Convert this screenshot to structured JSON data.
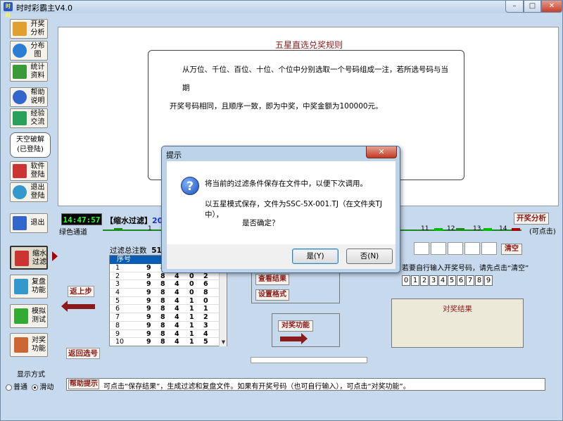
{
  "window": {
    "title": "时时彩霸主V4.0",
    "app_icon_text": "时时",
    "min": "–",
    "max": "□",
    "close": "✕"
  },
  "sidebar": {
    "items": [
      {
        "label": "开奖\n分析",
        "icon": "chart-icon",
        "color": "#e0a030"
      },
      {
        "label": "分布\n图",
        "icon": "globe-icon",
        "color": "#2a7fd4"
      },
      {
        "label": "统计\n资料",
        "icon": "stats-icon",
        "color": "#3a9a3a"
      },
      {
        "label": "帮助\n说明",
        "icon": "help-icon",
        "color": "#3366cc"
      },
      {
        "label": "经验\n交流",
        "icon": "users-icon",
        "color": "#2aa05a"
      }
    ],
    "account": {
      "title": "天空破解",
      "status": "(已登陆)"
    },
    "items2": [
      {
        "label": "软件\n登陆",
        "icon": "key-icon",
        "color": "#cc3333"
      },
      {
        "label": "退出\n登陆",
        "icon": "off-icon",
        "color": "#3399cc"
      },
      {
        "label": "退出",
        "icon": "exit-icon",
        "color": "#3366cc"
      }
    ],
    "modes": [
      {
        "label": "缩水\n过滤",
        "icon": "scissors-icon",
        "color": "#cc3333",
        "active": true
      },
      {
        "label": "复盘\n功能",
        "icon": "camera-icon",
        "color": "#3399cc",
        "active": false
      },
      {
        "label": "模拟\n测试",
        "icon": "refresh-icon",
        "color": "#33aa33",
        "active": false
      },
      {
        "label": "对奖\n功能",
        "icon": "puzzle-icon",
        "color": "#cc6633",
        "active": false
      }
    ],
    "display_label": "显示方式",
    "radio_normal": "普通",
    "radio_scroll": "滑动"
  },
  "rules": {
    "title": "五星直选兑奖规则",
    "line1": "从万位、千位、百位、十位、个位中分别选取一个号码组成一注，若所选号码与当期",
    "line2": "开奖号码相同，且顺序一致，即为中奖，中奖金额为100000元。"
  },
  "timebar": {
    "clock": "14:47:57",
    "filter_prefix": "【缩水过滤】",
    "year": "2016",
    "analyze_button": "开奖分析"
  },
  "green_channel": {
    "label": "绿色通道",
    "marks": [
      "1",
      "11",
      "12",
      "13",
      "14"
    ],
    "suffix": "(可点击)"
  },
  "left_panel": {
    "back_step": "返上步",
    "back_select": "返回选号",
    "total_label": "过滤总注数",
    "total_value": "51",
    "table_header": "序号",
    "rows": [
      {
        "n": "1",
        "d": [
          "9",
          "8",
          "4",
          "0",
          "1"
        ]
      },
      {
        "n": "2",
        "d": [
          "9",
          "8",
          "4",
          "0",
          "2"
        ]
      },
      {
        "n": "3",
        "d": [
          "9",
          "8",
          "4",
          "0",
          "6"
        ]
      },
      {
        "n": "4",
        "d": [
          "9",
          "8",
          "4",
          "0",
          "8"
        ]
      },
      {
        "n": "5",
        "d": [
          "9",
          "8",
          "4",
          "1",
          "0"
        ]
      },
      {
        "n": "6",
        "d": [
          "9",
          "8",
          "4",
          "1",
          "1"
        ]
      },
      {
        "n": "7",
        "d": [
          "9",
          "8",
          "4",
          "1",
          "2"
        ]
      },
      {
        "n": "8",
        "d": [
          "9",
          "8",
          "4",
          "1",
          "3"
        ]
      },
      {
        "n": "9",
        "d": [
          "9",
          "8",
          "4",
          "1",
          "4"
        ]
      },
      {
        "n": "10",
        "d": [
          "9",
          "8",
          "4",
          "1",
          "5"
        ]
      }
    ]
  },
  "middle_panel": {
    "view_results": "查看结果",
    "set_format": "设置格式",
    "prize_function": "对奖功能"
  },
  "right_panel": {
    "clear": "清空",
    "hint": "若要自行输入开奖号码，请先点击“清空”",
    "digits": [
      "0",
      "1",
      "2",
      "3",
      "4",
      "5",
      "6",
      "7",
      "8",
      "9"
    ],
    "result_title": "对奖结果"
  },
  "status": {
    "help_button": "帮助提示",
    "text": "可点击“保存结果”，生成过滤和复盘文件。如果有开奖号码（也可自行输入），可点击“对奖功能”。"
  },
  "dialog": {
    "title": "提示",
    "close": "✕",
    "icon": "?",
    "line1": "将当前的过滤条件保存在文件中，以便下次调用。",
    "line2": "以五星模式保存，文件为SSC-5X-001.TJ（在文件夹TJ中），",
    "line3": "是否确定？",
    "yes": "是(Y)",
    "no": "否(N)"
  }
}
